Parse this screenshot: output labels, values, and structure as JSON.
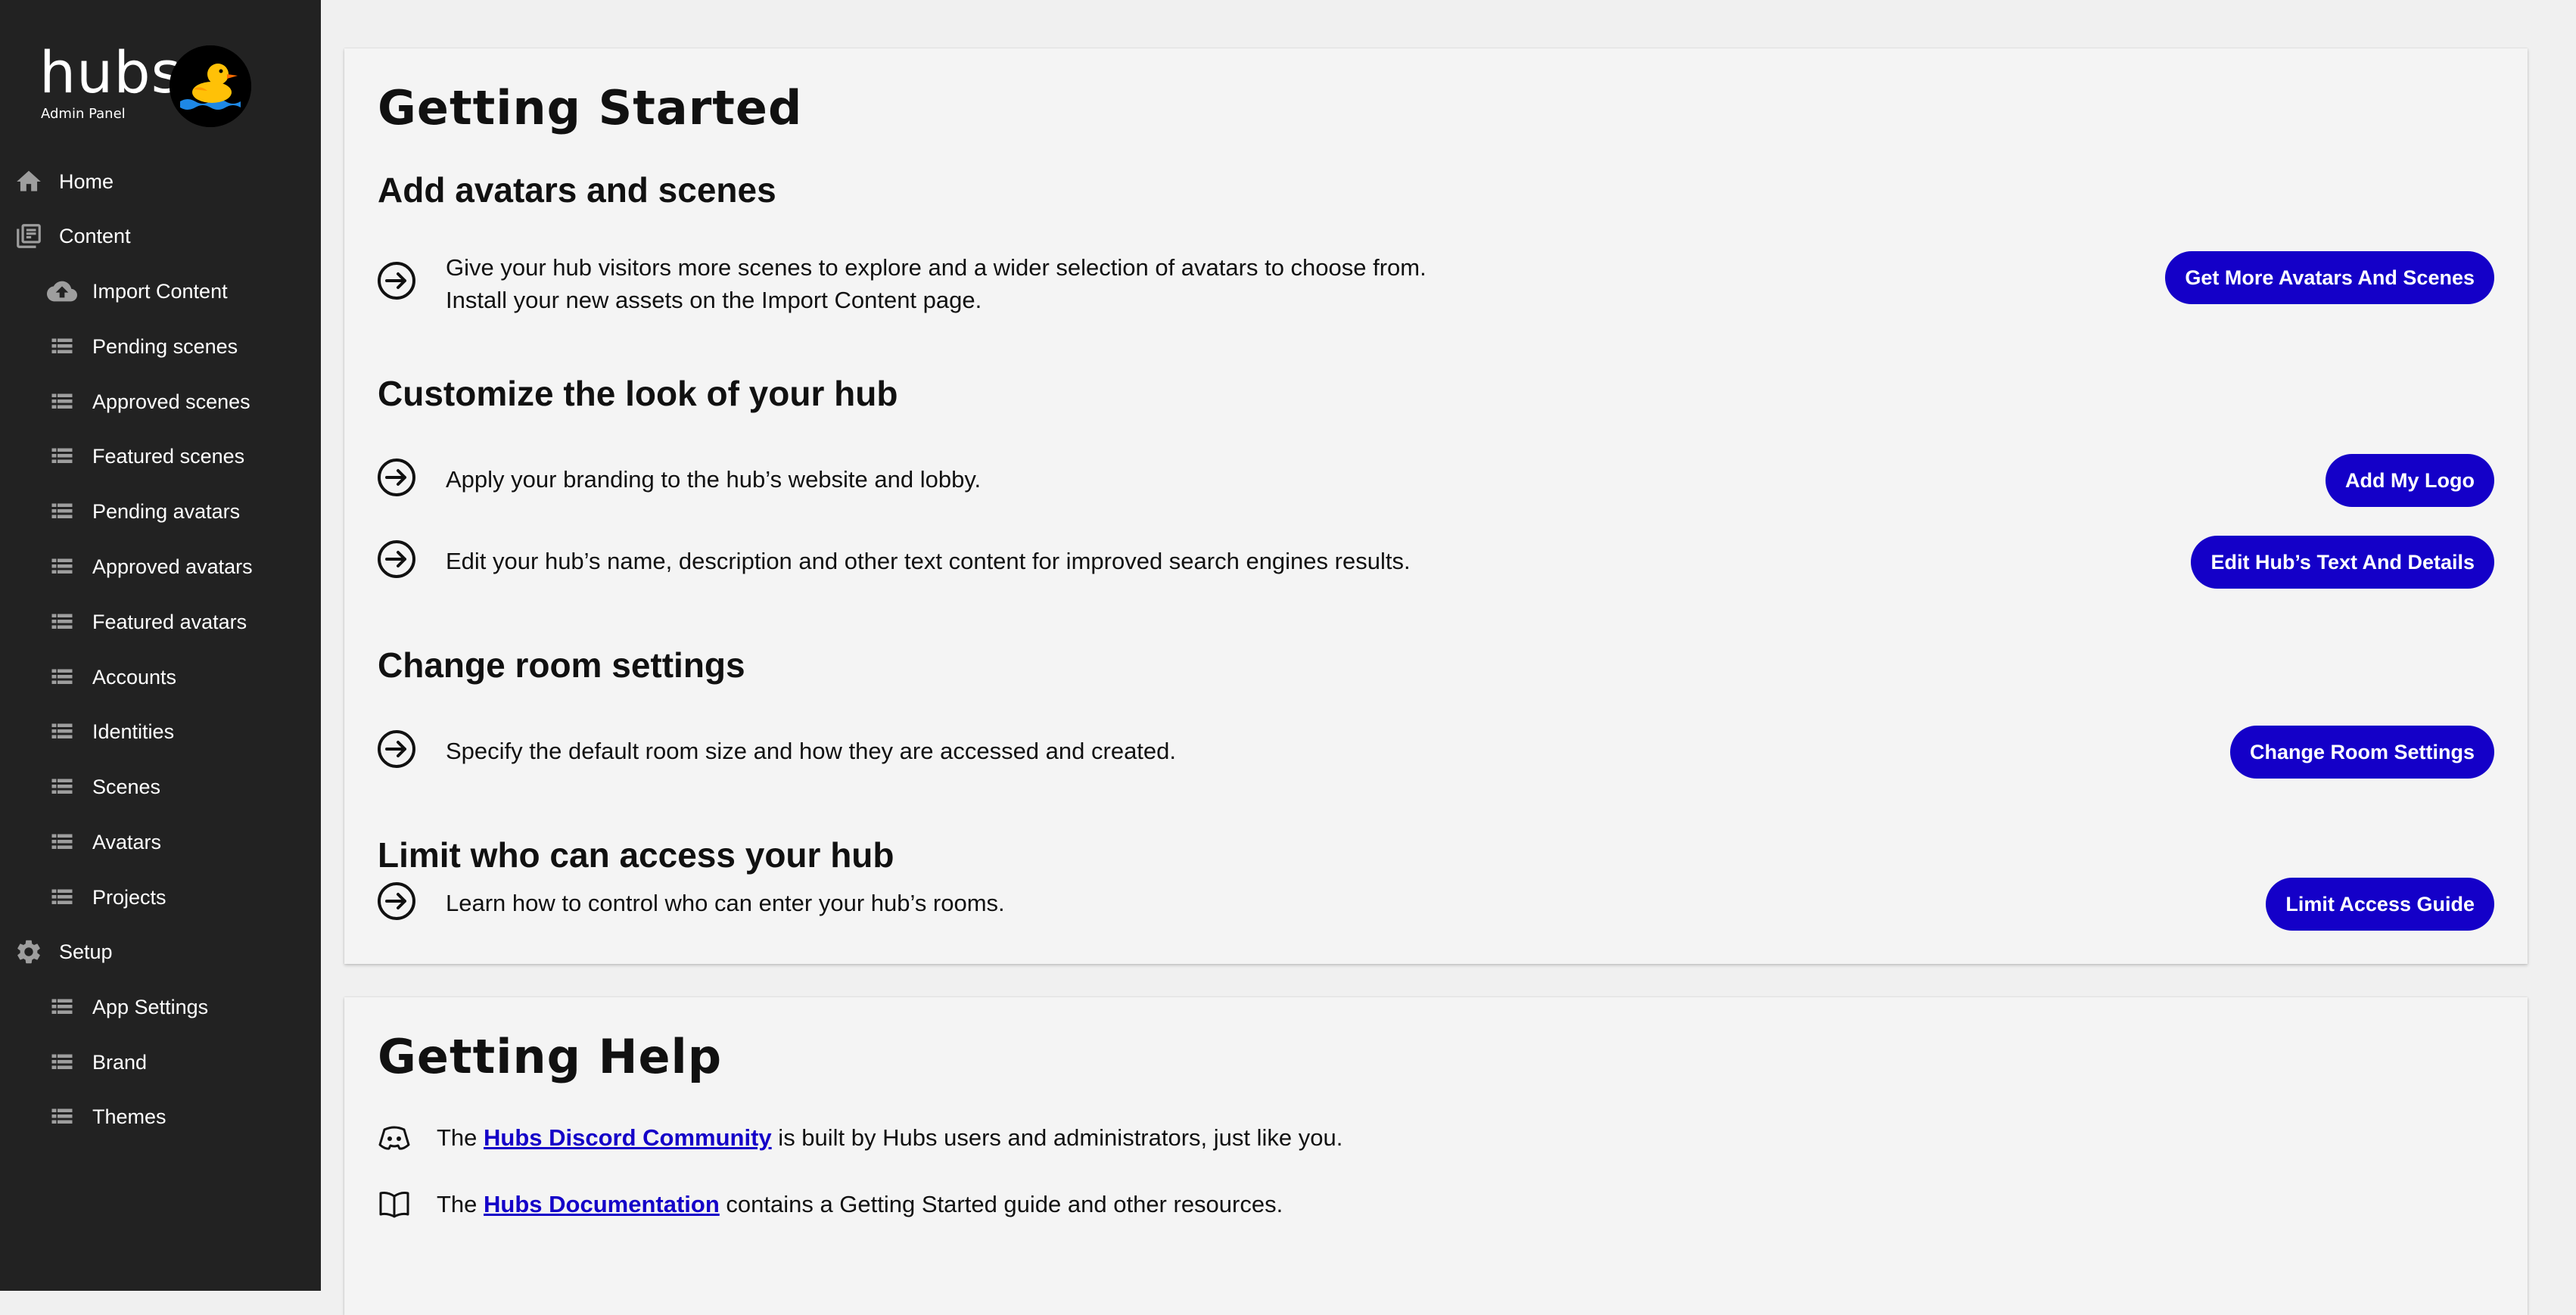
{
  "logo": {
    "wordmark": "hubs",
    "subtitle": "Admin Panel"
  },
  "sidebar": {
    "items": [
      {
        "label": "Home",
        "icon": "home-icon",
        "level": "top"
      },
      {
        "label": "Content",
        "icon": "library-icon",
        "level": "top"
      },
      {
        "label": "Import Content",
        "icon": "cloud-upload-icon",
        "level": "sub"
      },
      {
        "label": "Pending scenes",
        "icon": "list-icon",
        "level": "sub"
      },
      {
        "label": "Approved scenes",
        "icon": "list-icon",
        "level": "sub"
      },
      {
        "label": "Featured scenes",
        "icon": "list-icon",
        "level": "sub"
      },
      {
        "label": "Pending avatars",
        "icon": "list-icon",
        "level": "sub"
      },
      {
        "label": "Approved avatars",
        "icon": "list-icon",
        "level": "sub"
      },
      {
        "label": "Featured avatars",
        "icon": "list-icon",
        "level": "sub"
      },
      {
        "label": "Accounts",
        "icon": "list-icon",
        "level": "sub"
      },
      {
        "label": "Identities",
        "icon": "list-icon",
        "level": "sub"
      },
      {
        "label": "Scenes",
        "icon": "list-icon",
        "level": "sub"
      },
      {
        "label": "Avatars",
        "icon": "list-icon",
        "level": "sub"
      },
      {
        "label": "Projects",
        "icon": "list-icon",
        "level": "sub"
      },
      {
        "label": "Setup",
        "icon": "gear-icon",
        "level": "top"
      },
      {
        "label": "App Settings",
        "icon": "list-icon",
        "level": "sub"
      },
      {
        "label": "Brand",
        "icon": "list-icon",
        "level": "sub"
      },
      {
        "label": "Themes",
        "icon": "list-icon",
        "level": "sub"
      }
    ]
  },
  "getting_started": {
    "title": "Getting Started",
    "sections": {
      "avatars": {
        "heading": "Add avatars and scenes",
        "line1": "Give your hub visitors more scenes to explore and a wider selection of avatars to choose from.",
        "line2": "Install your new assets on the Import Content page.",
        "button": "Get More Avatars And Scenes"
      },
      "customize": {
        "heading": "Customize the look of your hub",
        "logo_text": "Apply your branding to the hub’s website and lobby.",
        "logo_button": "Add My Logo",
        "details_text": "Edit your hub’s name, description and other text content for improved search engines results.",
        "details_button": "Edit Hub’s Text And Details"
      },
      "room": {
        "heading": "Change room settings",
        "text": "Specify the default room size and how they are accessed and created.",
        "button": "Change Room Settings"
      },
      "access": {
        "heading": "Limit who can access your hub",
        "text": "Learn how to control who can enter your hub’s rooms.",
        "button": "Limit Access Guide"
      }
    }
  },
  "getting_help": {
    "title": "Getting Help",
    "discord": {
      "prefix": "The ",
      "link": "Hubs Discord Community",
      "suffix": " is built by Hubs users and administrators, just like you."
    },
    "docs": {
      "prefix": "The ",
      "link": "Hubs Documentation",
      "suffix": " contains a Getting Started guide and other resources."
    }
  },
  "colors": {
    "sidebar_bg": "#222222",
    "accent": "#1400c8",
    "page_bg": "#f0f0f0",
    "card_bg": "#f4f4f4"
  }
}
